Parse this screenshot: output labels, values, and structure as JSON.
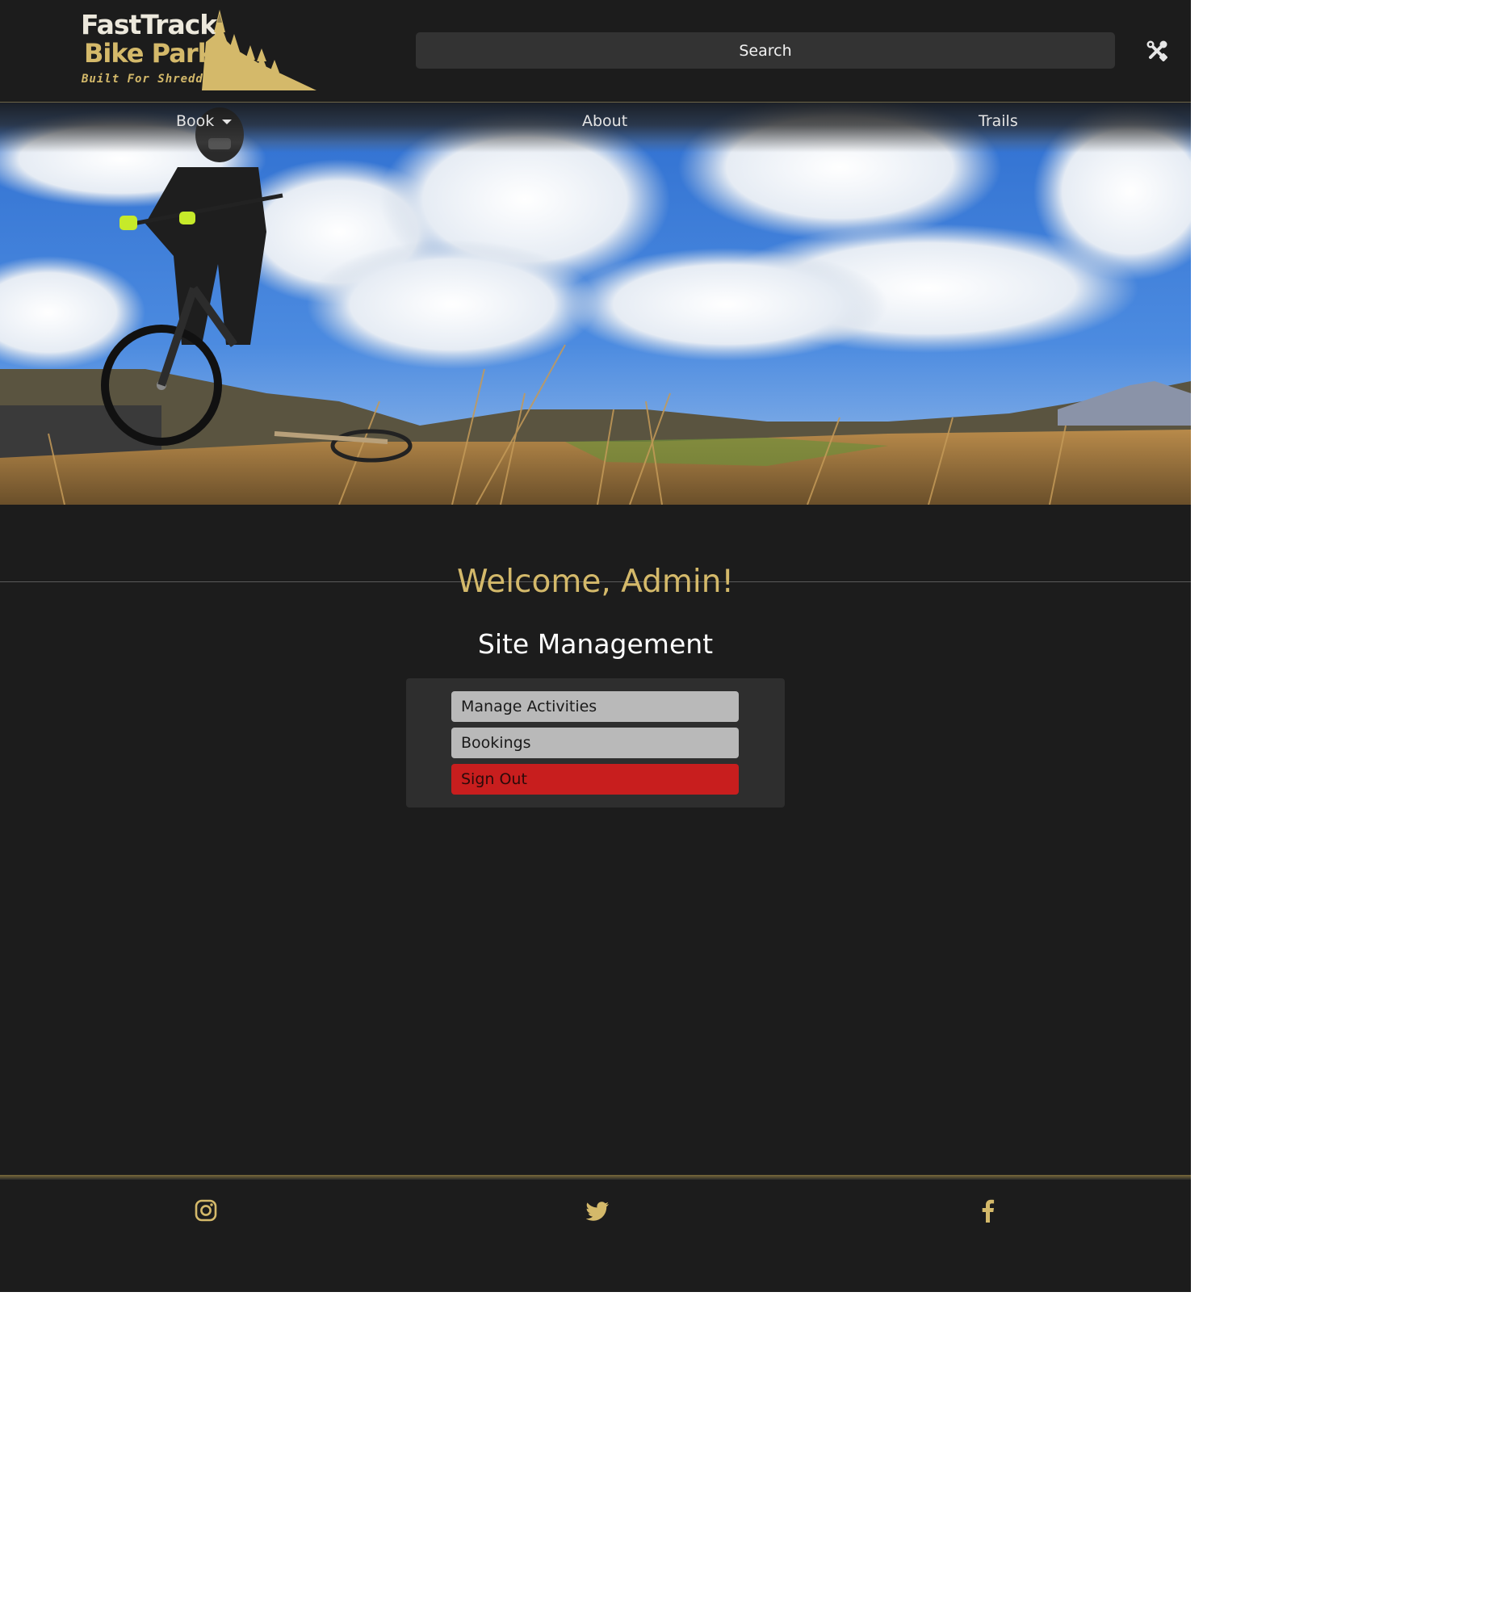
{
  "logo": {
    "line1": "FastTrack",
    "line2": "Bike Park",
    "tagline": "Built For Shredding"
  },
  "search": {
    "placeholder": "Search"
  },
  "toolbar": {
    "tools_icon": "tools-icon"
  },
  "nav": {
    "book": "Book",
    "about": "About",
    "trails": "Trails"
  },
  "main": {
    "welcome": "Welcome, Admin!",
    "section_title": "Site Management",
    "buttons": {
      "manage_activities": "Manage Activities",
      "bookings": "Bookings",
      "sign_out": "Sign Out"
    }
  },
  "footer": {
    "icons": [
      "instagram-icon",
      "twitter-icon",
      "facebook-icon"
    ]
  },
  "colors": {
    "background": "#1c1c1c",
    "accent_gold": "#d4b96a",
    "button_grey": "#b9b9b9",
    "button_red": "#c81e1e",
    "search_bg": "#333333"
  }
}
